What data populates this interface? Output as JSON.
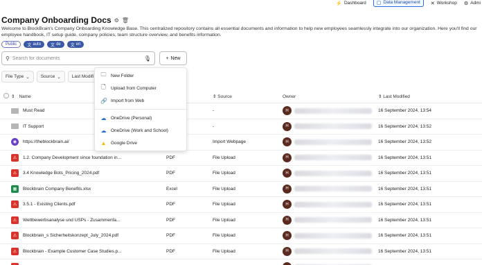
{
  "nav": {
    "items": [
      {
        "label": "Dashboard",
        "icon": "bolt-icon",
        "active": false
      },
      {
        "label": "Data Management",
        "icon": "document-icon",
        "active": true
      },
      {
        "label": "Workshop",
        "icon": "wrench-icon",
        "active": false
      },
      {
        "label": "Admi",
        "icon": "gear-icon",
        "active": false
      }
    ]
  },
  "header": {
    "title": "Company Onboarding Docs",
    "description": "Welcome to BlockBrain's Company Onboarding Knowledge Base. This centralized repository contains all essential documents and information to help new employees seamlessly integrate into our organization. Here you'll find our employee handbook, IT setup guide, company policies, team structure overview, and benefits information."
  },
  "tags": {
    "public": "Public",
    "langs": [
      "auto",
      "de",
      "en"
    ]
  },
  "search": {
    "placeholder": "Search for documents",
    "value": ""
  },
  "new_button": {
    "label": "New"
  },
  "filters": {
    "file_type": "File Type",
    "source": "Source",
    "last_modified": "Last Modifi"
  },
  "dropdown": {
    "items": [
      {
        "label": "New Folder",
        "icon": "new-folder-icon"
      },
      {
        "label": "Upload from Computer",
        "icon": "upload-file-icon"
      },
      {
        "label": "Import from Web",
        "icon": "link-icon"
      },
      {
        "label": "OneDrive (Personal)",
        "icon": "onedrive-icon"
      },
      {
        "label": "OneDrive (Work and School)",
        "icon": "onedrive-icon"
      },
      {
        "label": "Google Drive",
        "icon": "google-drive-icon"
      }
    ]
  },
  "table": {
    "headers": {
      "name": "Name",
      "type": "Type",
      "source": "Source",
      "owner": "Owner",
      "modified": "Last Modified"
    },
    "rows": [
      {
        "name": "Must Read",
        "kind": "folder",
        "type": "",
        "source": "-",
        "owner": "H",
        "modified": "16 September 2024, 13:54"
      },
      {
        "name": "IT Support",
        "kind": "folder",
        "type": "",
        "source": "-",
        "owner": "H",
        "modified": "16 September 2024, 13:52"
      },
      {
        "name": "https://theblockbrain.ai/",
        "kind": "web",
        "type": "Note",
        "source": "Import Webpage",
        "owner": "H",
        "modified": "16 September 2024, 13:52"
      },
      {
        "name": "1.2. Company Development since foundation in...",
        "kind": "pdf",
        "type": "PDF",
        "source": "File Upload",
        "owner": "H",
        "modified": "16 September 2024, 13:51"
      },
      {
        "name": "3.4 Knowledge Bots_Pricing_2024.pdf",
        "kind": "pdf",
        "type": "PDF",
        "source": "File Upload",
        "owner": "H",
        "modified": "16 September 2024, 13:51"
      },
      {
        "name": "Blockbrain Company Benefits.xlsx",
        "kind": "excel",
        "type": "Excel",
        "source": "File Upload",
        "owner": "H",
        "modified": "16 September 2024, 13:51"
      },
      {
        "name": "3.5.1 - Existing Clients.pdf",
        "kind": "pdf",
        "type": "PDF",
        "source": "File Upload",
        "owner": "H",
        "modified": "16 September 2024, 13:51"
      },
      {
        "name": "Wettbewerbsanalyse und USPs - Zusammenfa...",
        "kind": "pdf",
        "type": "PDF",
        "source": "File Upload",
        "owner": "H",
        "modified": "16 September 2024, 13:51"
      },
      {
        "name": "Blockbrain_s Sicherheitskonzept_July_2024.pdf",
        "kind": "pdf",
        "type": "PDF",
        "source": "File Upload",
        "owner": "H",
        "modified": "16 September 2024, 13:51"
      },
      {
        "name": "Blockbrain - Example Customer Case Studies.p...",
        "kind": "pdf",
        "type": "PDF",
        "source": "File Upload",
        "owner": "H",
        "modified": "16 September 2024, 13:51"
      },
      {
        "name": "",
        "kind": "pdf",
        "type": "",
        "source": "",
        "owner": "",
        "modified": ""
      }
    ]
  },
  "colors": {
    "accent": "#2b6de0",
    "tag_blue": "#3a59a6",
    "pdf_red": "#d9342b",
    "excel_green": "#1e8a4c",
    "avatar": "#5a2a1e"
  }
}
